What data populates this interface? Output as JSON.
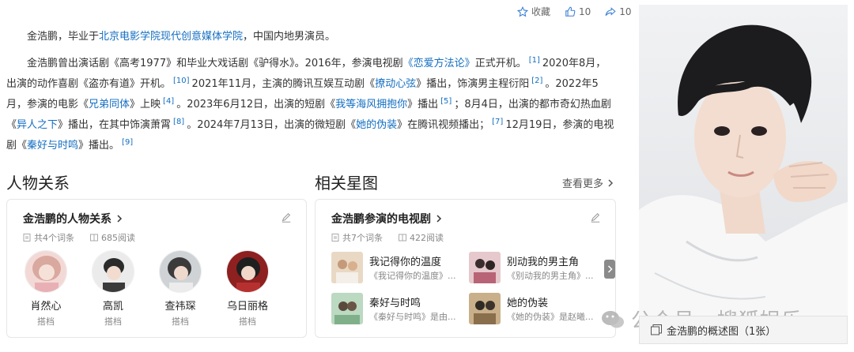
{
  "actions": {
    "favorite_label": "收藏",
    "like_count": "10",
    "share_count": "10"
  },
  "article": {
    "p1": {
      "prefix": "金浩鹏，毕业于",
      "school_link": "北京电影学院现代创意媒体学院",
      "suffix": "，中国内地男演员。"
    },
    "p2": {
      "t1": "金浩鹏曾出演话剧《高考1977》和毕业大戏话剧《驴得水》。2016年，参演电视剧",
      "l1": "《恋爱方法论》",
      "t2": "正式开机。",
      "r1": "[1]",
      "t3": "2020年8月，出演的动作喜剧《盗亦有道》开机。",
      "r2": "[10]",
      "t4": "2021年11月，主演的腾讯互娱互动剧《",
      "l2": "撩动心弦",
      "t5": "》播出，饰演男主程衍阳",
      "r3": "[2]",
      "t6": "。2022年5月，参演的电影《",
      "l3": "兄弟同体",
      "t7": "》上映",
      "r4": "[4]",
      "t8": "。2023年6月12日，出演的短剧《",
      "l4": "我等海风拥抱你",
      "t9": "》播出",
      "r5": "[5]",
      "t10": "；8月4日，出演的都市奇幻热血剧《",
      "l5": "异人之下",
      "t11": "》播出，在其中饰演萧霄",
      "r6": "[8]",
      "t12": "。2024年7月13日，出演的微短剧《",
      "l6": "她的伪装",
      "t13": "》在腾讯视频播出；",
      "r7": "[7]",
      "t14": "12月19日，参演的电视剧《",
      "l7": "秦好与时鸣",
      "t15": "》播出。",
      "r8": "[9]"
    }
  },
  "relations": {
    "section_title": "人物关系",
    "card_title": "金浩鹏的人物关系",
    "entries": "共4个词条",
    "reads": "685阅读",
    "people": [
      {
        "name": "肖然心",
        "role": "搭档"
      },
      {
        "name": "高凯",
        "role": "搭档"
      },
      {
        "name": "查祎琛",
        "role": "搭档"
      },
      {
        "name": "乌日丽格",
        "role": "搭档"
      }
    ]
  },
  "stars": {
    "section_title": "相关星图",
    "more_label": "查看更多",
    "card_title": "金浩鹏参演的电视剧",
    "entries": "共7个词条",
    "reads": "422阅读",
    "dramas": [
      {
        "title": "我记得你的温度",
        "sub": "《我记得你的温度》..."
      },
      {
        "title": "别动我的男主角",
        "sub": "《别动我的男主角》..."
      },
      {
        "title": "秦好与时鸣",
        "sub": "《秦好与时鸣》是由..."
      },
      {
        "title": "她的伪装",
        "sub": "《她的伪装》是赵曦..."
      }
    ]
  },
  "photo": {
    "watermark": "公众号 · 搜狐娱乐",
    "caption": "金浩鹏的概述图（1张）"
  },
  "colors": {
    "link": "#136ec2",
    "text": "#333333",
    "muted": "#888888"
  }
}
